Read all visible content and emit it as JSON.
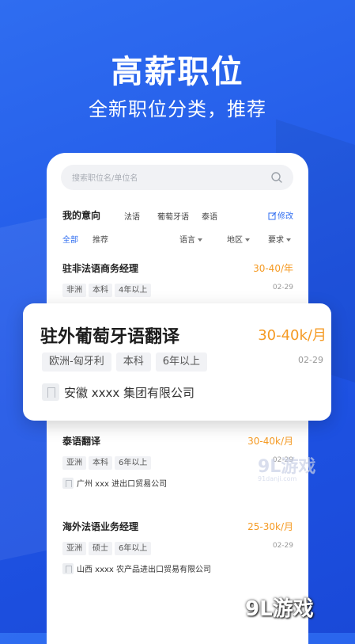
{
  "hero": {
    "title": "高薪职位",
    "subtitle": "全新职位分类，推荐"
  },
  "search": {
    "placeholder": "搜索职位名/单位名"
  },
  "intent": {
    "label": "我的意向",
    "tags": [
      "法语",
      "葡萄牙语",
      "泰语"
    ],
    "edit_label": "修改"
  },
  "filters": {
    "all": "全部",
    "recommend": "推荐",
    "dropdowns": [
      "语言",
      "地区",
      "要求"
    ]
  },
  "jobs": [
    {
      "title": "驻非法语商务经理",
      "salary": "30-40/年",
      "date": "02-29",
      "tags": [
        "非洲",
        "本科",
        "4年以上"
      ],
      "company": ""
    },
    {
      "title": "泰语翻译",
      "salary": "30-40k/月",
      "date": "02-29",
      "tags": [
        "亚洲",
        "本科",
        "6年以上"
      ],
      "company": "广州 xxx 进出口贸易公司"
    },
    {
      "title": "海外法语业务经理",
      "salary": "25-30k/月",
      "date": "02-29",
      "tags": [
        "亚洲",
        "硕士",
        "6年以上"
      ],
      "company": "山西 xxxx 农产品进出口贸易有限公司"
    }
  ],
  "featured": {
    "title": "驻外葡萄牙语翻译",
    "salary": "30-40k/月",
    "date": "02-29",
    "tags": [
      "欧洲-匈牙利",
      "本科",
      "6年以上"
    ],
    "company": "安徽 xxxx 集团有限公司"
  },
  "watermark": {
    "mid_brand": "9L游戏",
    "mid_url": "91danji.com",
    "bottom_brand": "9L游戏"
  },
  "colors": {
    "background": "#2f6df0",
    "accent": "#2f6df0",
    "salary": "#f59a23"
  }
}
